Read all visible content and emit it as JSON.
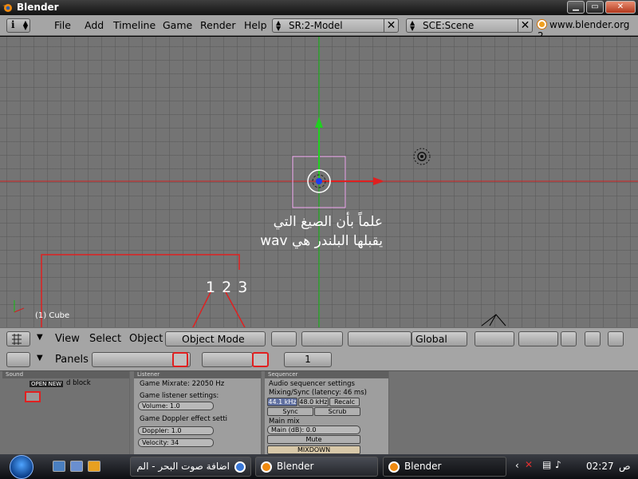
{
  "window": {
    "title": "Blender",
    "buttons": [
      "minimize",
      "maximize",
      "close"
    ]
  },
  "menubar": {
    "menus": [
      "File",
      "Add",
      "Timeline",
      "Game",
      "Render",
      "Help"
    ],
    "screen_field": "SR:2-Model",
    "scene_field": "SCE:Scene",
    "website": "www.blender.org 2"
  },
  "viewport": {
    "annotation_line1": "علماً بأن الصيغ التي",
    "annotation_line2": "يقبلها البلندر هي wav",
    "numbers": "1 2 3",
    "object_label": "(1) Cube",
    "colors": {
      "x_axis": "#e01010",
      "y_axis": "#10c010",
      "annotation": "#e02020"
    }
  },
  "header3d": {
    "menus": [
      "View",
      "Select",
      "Object"
    ],
    "mode": "Object Mode",
    "orientation": "Global"
  },
  "buttons_window": {
    "panels_label": "Panels",
    "frame": "1",
    "sound_panel": {
      "title": "Sound",
      "text": "d block",
      "tooltip": "OPEN NEW"
    },
    "listener_panel": {
      "title": "Listener",
      "mixrate": "Game Mixrate: 22050 Hz",
      "listener_settings": "Game listener settings:",
      "volume": "Volume: 1.0",
      "doppler_settings": "Game Doppler effect setti",
      "doppler": "Doppler: 1.0",
      "velocity": "Velocity: 34"
    },
    "sequencer_panel": {
      "title": "Sequencer",
      "settings": "Audio sequencer settings",
      "mixing": "Mixing/Sync (latency: 46 ms)",
      "rate1": "44.1 kHz",
      "rate2": "48.0 kHz",
      "recalc": "Recalc",
      "sync": "Sync",
      "scrub": "Scrub",
      "main_mix": "Main mix",
      "main_db": "Main (dB): 0.0",
      "mute": "Mute",
      "mixdown": "MIXDOWN"
    }
  },
  "taskbar": {
    "tasks": [
      "اضافة صوت البحر - الم",
      "Blender",
      "Blender"
    ],
    "clock": "02:27",
    "ampm": "ص"
  }
}
